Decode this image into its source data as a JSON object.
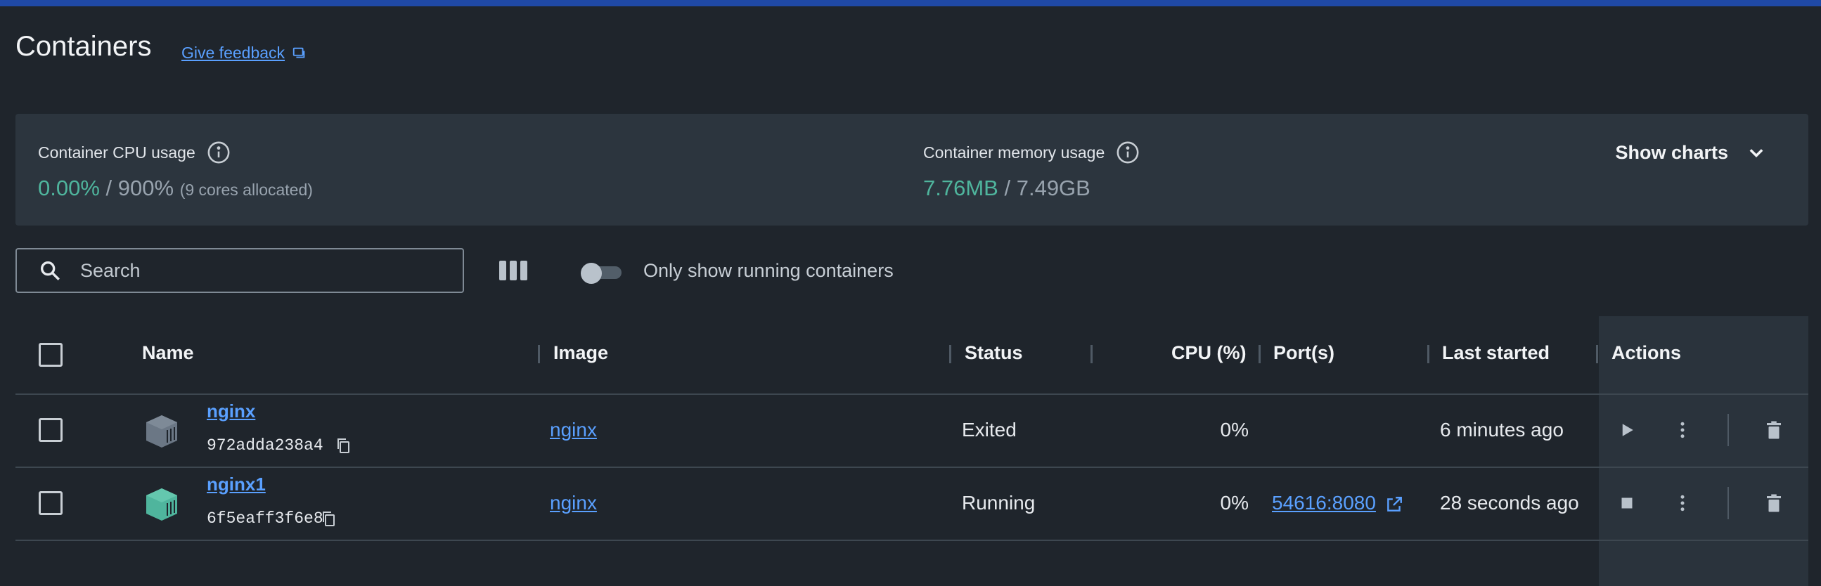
{
  "header": {
    "title": "Containers",
    "feedback_label": "Give feedback"
  },
  "stats": {
    "cpu": {
      "label": "Container CPU usage",
      "used": "0.00%",
      "separator": "/",
      "total": "900%",
      "note": "(9 cores allocated)"
    },
    "memory": {
      "label": "Container memory usage",
      "used": "7.76MB",
      "separator": "/",
      "total": "7.49GB"
    },
    "show_charts_label": "Show charts"
  },
  "toolbar": {
    "search_placeholder": "Search",
    "only_running_label": "Only show running containers",
    "only_running_enabled": false
  },
  "table": {
    "columns": [
      "Name",
      "Image",
      "Status",
      "CPU (%)",
      "Port(s)",
      "Last started",
      "Actions"
    ],
    "rows": [
      {
        "name": "nginx",
        "id": "972adda238a4",
        "image": "nginx",
        "status": "Exited",
        "cpu": "0%",
        "ports": "",
        "last_started": "6 minutes ago",
        "icon_color": "#6b7785",
        "primary_action": "play-icon"
      },
      {
        "name": "nginx1",
        "id": "6f5eaff3f6e8",
        "image": "nginx",
        "status": "Running",
        "cpu": "0%",
        "ports": "54616:8080",
        "last_started": "28 seconds ago",
        "icon_color": "#4fb59d",
        "primary_action": "stop-icon"
      }
    ]
  },
  "colors": {
    "accent": "#1f49a6",
    "link": "#5aa0ff",
    "usage_green": "#4fb59d",
    "background": "#1f252c"
  }
}
